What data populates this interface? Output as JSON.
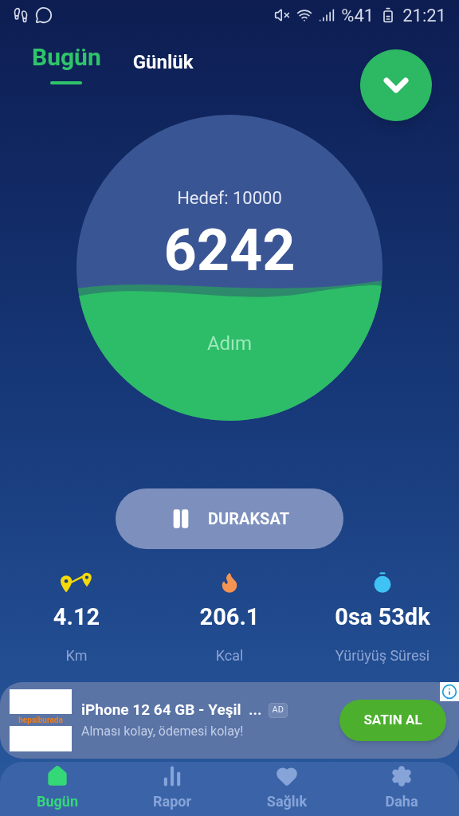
{
  "status_bar": {
    "battery": "%41",
    "time": "21:21"
  },
  "tabs": [
    {
      "label": "Bugün",
      "selected": true
    },
    {
      "label": "Günlük",
      "selected": false
    }
  ],
  "goal": {
    "label": "Hedef: 10000",
    "steps": "6242",
    "unit": "Adım"
  },
  "pause_button": {
    "label": "DURAKSAT"
  },
  "stats": [
    {
      "kind": "distance",
      "value": "4.12",
      "unit": "Km"
    },
    {
      "kind": "calories",
      "value": "206.1",
      "unit": "Kcal"
    },
    {
      "kind": "time",
      "value": "0sa 53dk",
      "unit": "Yürüyüş Süresi"
    }
  ],
  "ad": {
    "brand": "hepsiburada",
    "title": "iPhone 12 64 GB - Yeşil  ...",
    "badge": "AD",
    "subtitle": "Alması kolay, ödemesi kolay!",
    "button": "SATIN AL"
  },
  "nav": [
    {
      "kind": "home",
      "label": "Bugün",
      "selected": true
    },
    {
      "kind": "report",
      "label": "Rapor",
      "selected": false
    },
    {
      "kind": "health",
      "label": "Sağlık",
      "selected": false
    },
    {
      "kind": "more",
      "label": "Daha",
      "selected": false
    }
  ]
}
